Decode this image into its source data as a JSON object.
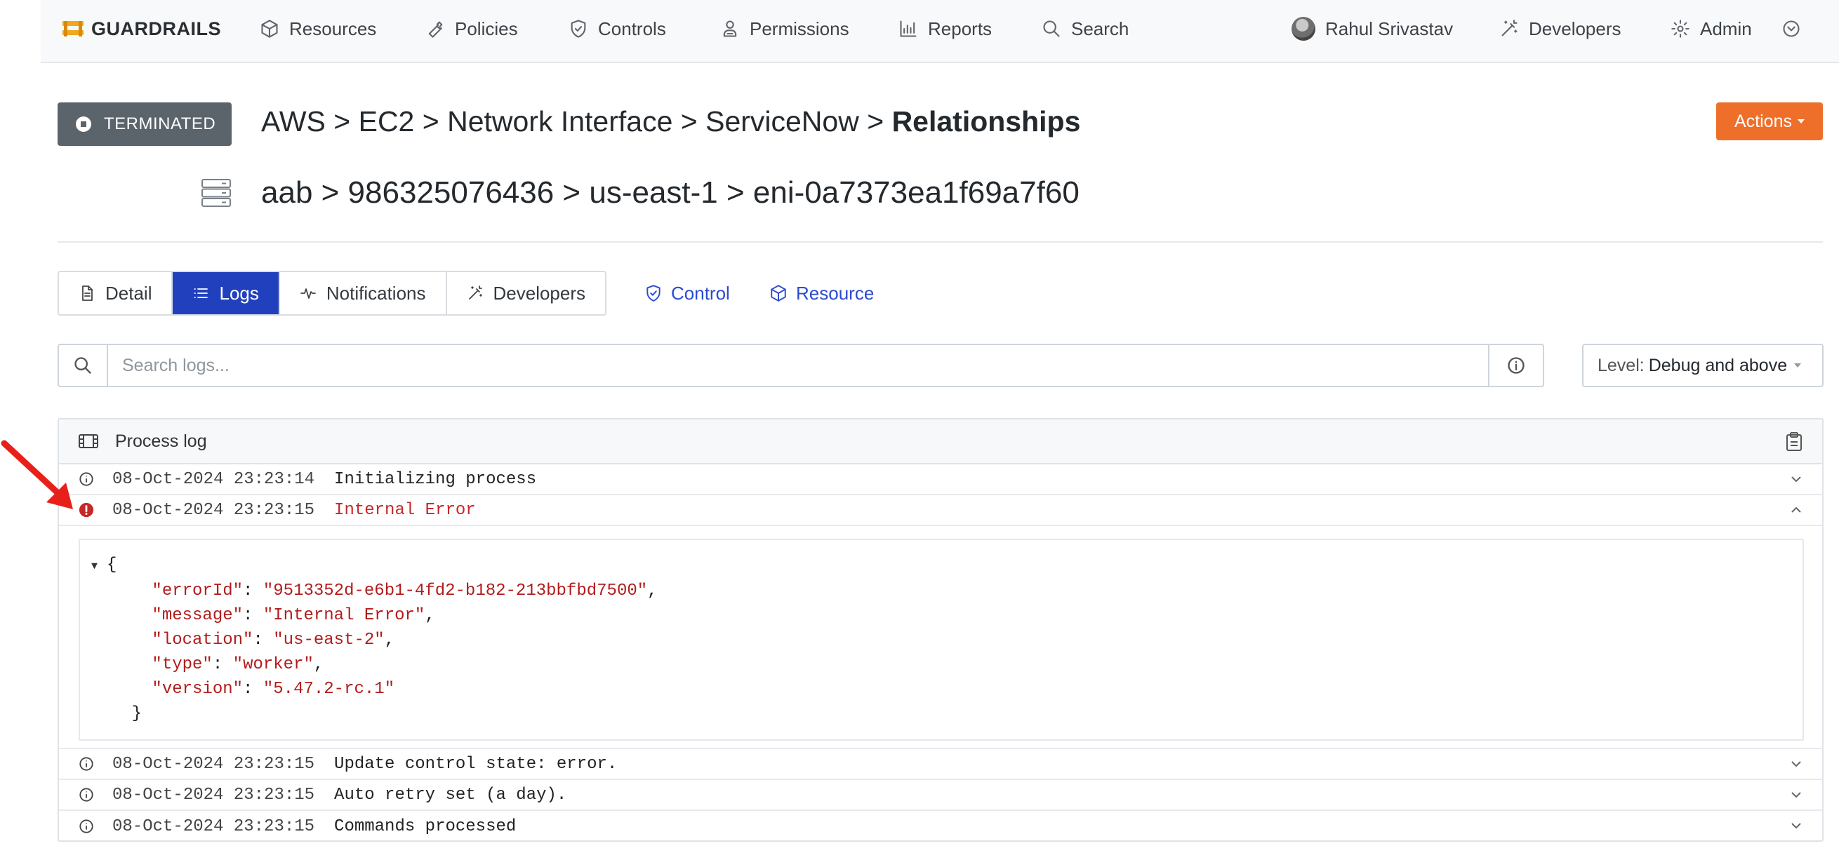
{
  "navbar": {
    "brand": "GUARDRAILS",
    "items": [
      {
        "label": "Resources",
        "icon": "cube-icon"
      },
      {
        "label": "Policies",
        "icon": "wrench-icon"
      },
      {
        "label": "Controls",
        "icon": "shield-check-icon"
      },
      {
        "label": "Permissions",
        "icon": "user-badge-icon"
      },
      {
        "label": "Reports",
        "icon": "bar-chart-icon"
      },
      {
        "label": "Search",
        "icon": "search-icon"
      }
    ],
    "user": "Rahul Srivastav",
    "developers": "Developers",
    "admin": "Admin"
  },
  "header": {
    "status_badge": "TERMINATED",
    "breadcrumb_1": {
      "path": "AWS > EC2 > Network Interface > ServiceNow > ",
      "current": "Relationships"
    },
    "breadcrumb_2": "aab > 986325076436 > us-east-1 > eni-0a7373ea1f69a7f60",
    "actions_label": "Actions",
    "actions_color": "#ee6f2a"
  },
  "tabs": [
    {
      "label": "Detail",
      "icon": "document-icon",
      "active": false
    },
    {
      "label": "Logs",
      "icon": "list-icon",
      "active": true
    },
    {
      "label": "Notifications",
      "icon": "pulse-icon",
      "active": false
    },
    {
      "label": "Developers",
      "icon": "magic-wand-icon",
      "active": false
    }
  ],
  "links": {
    "control": "Control",
    "resource": "Resource"
  },
  "search": {
    "placeholder": "Search logs...",
    "value": ""
  },
  "level": {
    "label": "Level:",
    "value": "Debug and above"
  },
  "log": {
    "title": "Process log",
    "entries": [
      {
        "timestamp": "08-Oct-2024 23:23:14",
        "message": "Initializing process",
        "level": "info",
        "expanded": false
      },
      {
        "timestamp": "08-Oct-2024 23:23:15",
        "message": "Internal Error",
        "level": "error",
        "expanded": true
      },
      {
        "timestamp": "08-Oct-2024 23:23:15",
        "message": "Update control state: error.",
        "level": "info",
        "expanded": false
      },
      {
        "timestamp": "08-Oct-2024 23:23:15",
        "message": "Auto retry set (a day).",
        "level": "info",
        "expanded": false
      },
      {
        "timestamp": "08-Oct-2024 23:23:15",
        "message": "Commands processed",
        "level": "info",
        "expanded": false
      }
    ],
    "error_detail": {
      "errorId": "9513352d-e6b1-4fd2-b182-213bbfbd7500",
      "message": "Internal Error",
      "location": "us-east-2",
      "type": "worker",
      "version": "5.47.2-rc.1"
    }
  },
  "colors": {
    "primary": "#2140be",
    "link": "#2b4bd1",
    "error": "#c62828",
    "badge": "#5b636b"
  }
}
